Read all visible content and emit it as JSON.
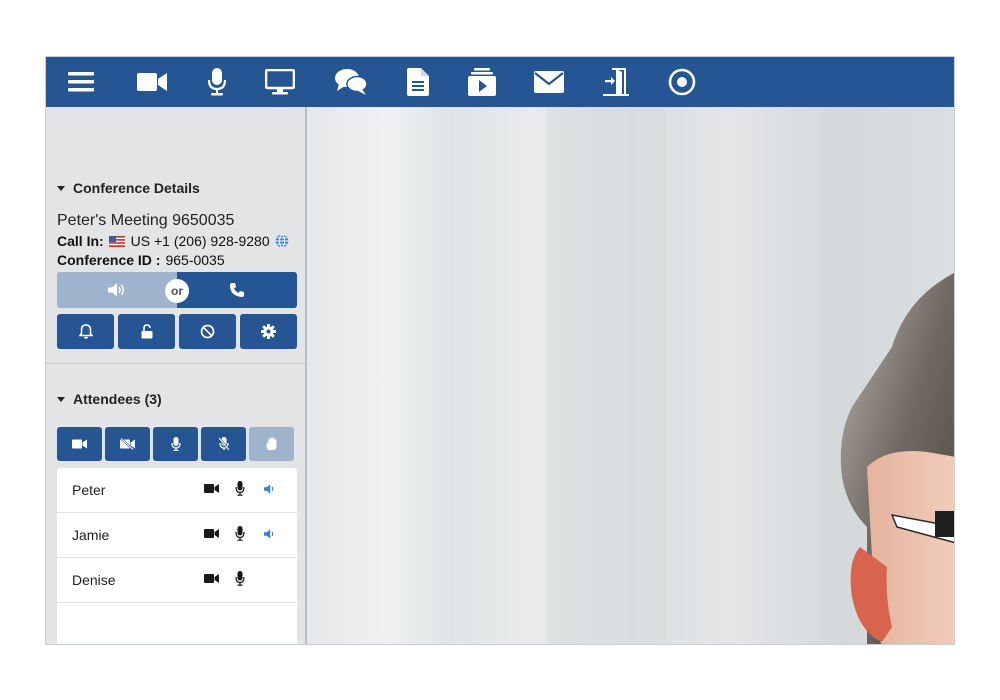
{
  "toolbar": {
    "icons": [
      "menu-icon",
      "video-icon",
      "microphone-icon",
      "monitor-icon",
      "chat-icon",
      "document-icon",
      "media-player-icon",
      "mail-icon",
      "exit-door-icon",
      "record-icon"
    ]
  },
  "conference": {
    "section_title": "Conference Details",
    "meeting_name": "Peter's Meeting 9650035",
    "call_in_label": "Call In:",
    "call_in_number": "US +1 (206) 928-9280",
    "conference_id_label": "Conference ID :",
    "conference_id": "965-0035",
    "or_label": "or"
  },
  "attendees": {
    "section_title": "Attendees (3)",
    "list": [
      {
        "name": "Peter",
        "video": true,
        "mic": true,
        "speaking": true
      },
      {
        "name": "Jamie",
        "video": true,
        "mic": true,
        "speaking": true
      },
      {
        "name": "Denise",
        "video": true,
        "mic": true,
        "speaking": false
      }
    ]
  },
  "colors": {
    "primary": "#255593",
    "primary_light": "#9fb4cc",
    "sidebar_bg": "#e3e4e6",
    "speaking_blue": "#2f86d6"
  }
}
